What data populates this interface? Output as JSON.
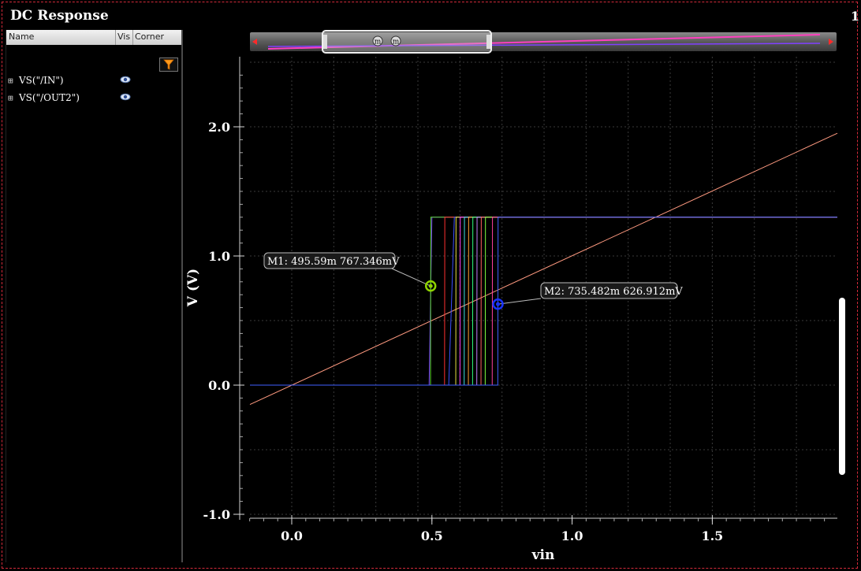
{
  "window": {
    "title": "DC Response",
    "page_number": "1"
  },
  "panel": {
    "columns": {
      "name": "Name",
      "vis": "Vis",
      "corner": "Corner"
    },
    "filter_icon": "filter-icon",
    "signals": [
      {
        "label": "VS(\"/IN\")",
        "visible": true
      },
      {
        "label": "VS(\"/OUT2\")",
        "visible": true
      }
    ]
  },
  "markers": [
    {
      "label": "M1: 495.59m 767.346mV",
      "x": 0.49559,
      "y": 0.767346,
      "color": "#8fd400"
    },
    {
      "label": "M2: 735.482m 626.912mV",
      "x": 0.735482,
      "y": 0.626912,
      "color": "#1a33ff"
    }
  ],
  "overview": {
    "marker_labels": [
      "m",
      "m"
    ]
  },
  "chart_data": {
    "type": "line",
    "title": "",
    "xlabel": "vin",
    "ylabel": "V (V)",
    "xlim": [
      -0.15,
      1.95
    ],
    "ylim": [
      -1.0,
      2.5
    ],
    "xticks": [
      "0.0",
      "0.5",
      "1.0",
      "1.5"
    ],
    "yticks": [
      "2.0",
      "1.0",
      "0.0",
      "-1.0"
    ],
    "xtick_values": [
      0.0,
      0.5,
      1.0,
      1.5
    ],
    "ytick_values": [
      2.0,
      1.0,
      0.0,
      -1.0
    ],
    "grid": true,
    "series": [
      {
        "color": "#ff9a80",
        "x": [
          -0.15,
          1.95
        ],
        "y": [
          -0.15,
          1.95
        ]
      },
      {
        "color": "#7a3cff",
        "x": [
          -0.15,
          0.49,
          0.5,
          1.95
        ],
        "y": [
          0.0,
          0.0,
          1.3,
          1.3
        ]
      },
      {
        "color": "#5cdc30",
        "x": [
          -0.15,
          0.495,
          0.496,
          1.95
        ],
        "y": [
          0.0,
          0.0,
          1.3,
          1.3
        ]
      },
      {
        "color": "#ff3030",
        "x": [
          -0.15,
          0.545,
          0.546,
          1.95
        ],
        "y": [
          0.0,
          0.0,
          1.3,
          1.3
        ]
      },
      {
        "color": "#3c50ff",
        "x": [
          -0.15,
          0.56,
          0.58,
          1.95
        ],
        "y": [
          0.0,
          0.0,
          1.3,
          1.3
        ]
      },
      {
        "color": "#e8e040",
        "x": [
          -0.15,
          0.585,
          0.586,
          1.95
        ],
        "y": [
          0.0,
          0.0,
          1.3,
          1.3
        ]
      },
      {
        "color": "#ff40ff",
        "x": [
          -0.15,
          0.6,
          0.601,
          1.95
        ],
        "y": [
          0.0,
          0.0,
          1.3,
          1.3
        ]
      },
      {
        "color": "#40e0e0",
        "x": [
          -0.15,
          0.615,
          0.616,
          1.95
        ],
        "y": [
          0.0,
          0.0,
          1.3,
          1.3
        ]
      },
      {
        "color": "#ffa030",
        "x": [
          -0.15,
          0.63,
          0.631,
          1.95
        ],
        "y": [
          0.0,
          0.0,
          1.3,
          1.3
        ]
      },
      {
        "color": "#30ff80",
        "x": [
          -0.15,
          0.645,
          0.646,
          1.95
        ],
        "y": [
          0.0,
          0.0,
          1.3,
          1.3
        ]
      },
      {
        "color": "#c080ff",
        "x": [
          -0.15,
          0.66,
          0.661,
          1.95
        ],
        "y": [
          0.0,
          0.0,
          1.3,
          1.3
        ]
      },
      {
        "color": "#ff6060",
        "x": [
          -0.15,
          0.675,
          0.676,
          1.95
        ],
        "y": [
          0.0,
          0.0,
          1.3,
          1.3
        ]
      },
      {
        "color": "#80ff40",
        "x": [
          -0.15,
          0.69,
          0.691,
          1.95
        ],
        "y": [
          0.0,
          0.0,
          1.3,
          1.3
        ]
      },
      {
        "color": "#ff40a0",
        "x": [
          -0.15,
          0.715,
          0.716,
          1.95
        ],
        "y": [
          0.0,
          0.0,
          1.3,
          1.3
        ]
      },
      {
        "color": "#4060ff",
        "x": [
          -0.15,
          0.735,
          0.736,
          1.95
        ],
        "y": [
          0.0,
          0.0,
          1.3,
          1.3
        ]
      }
    ]
  }
}
